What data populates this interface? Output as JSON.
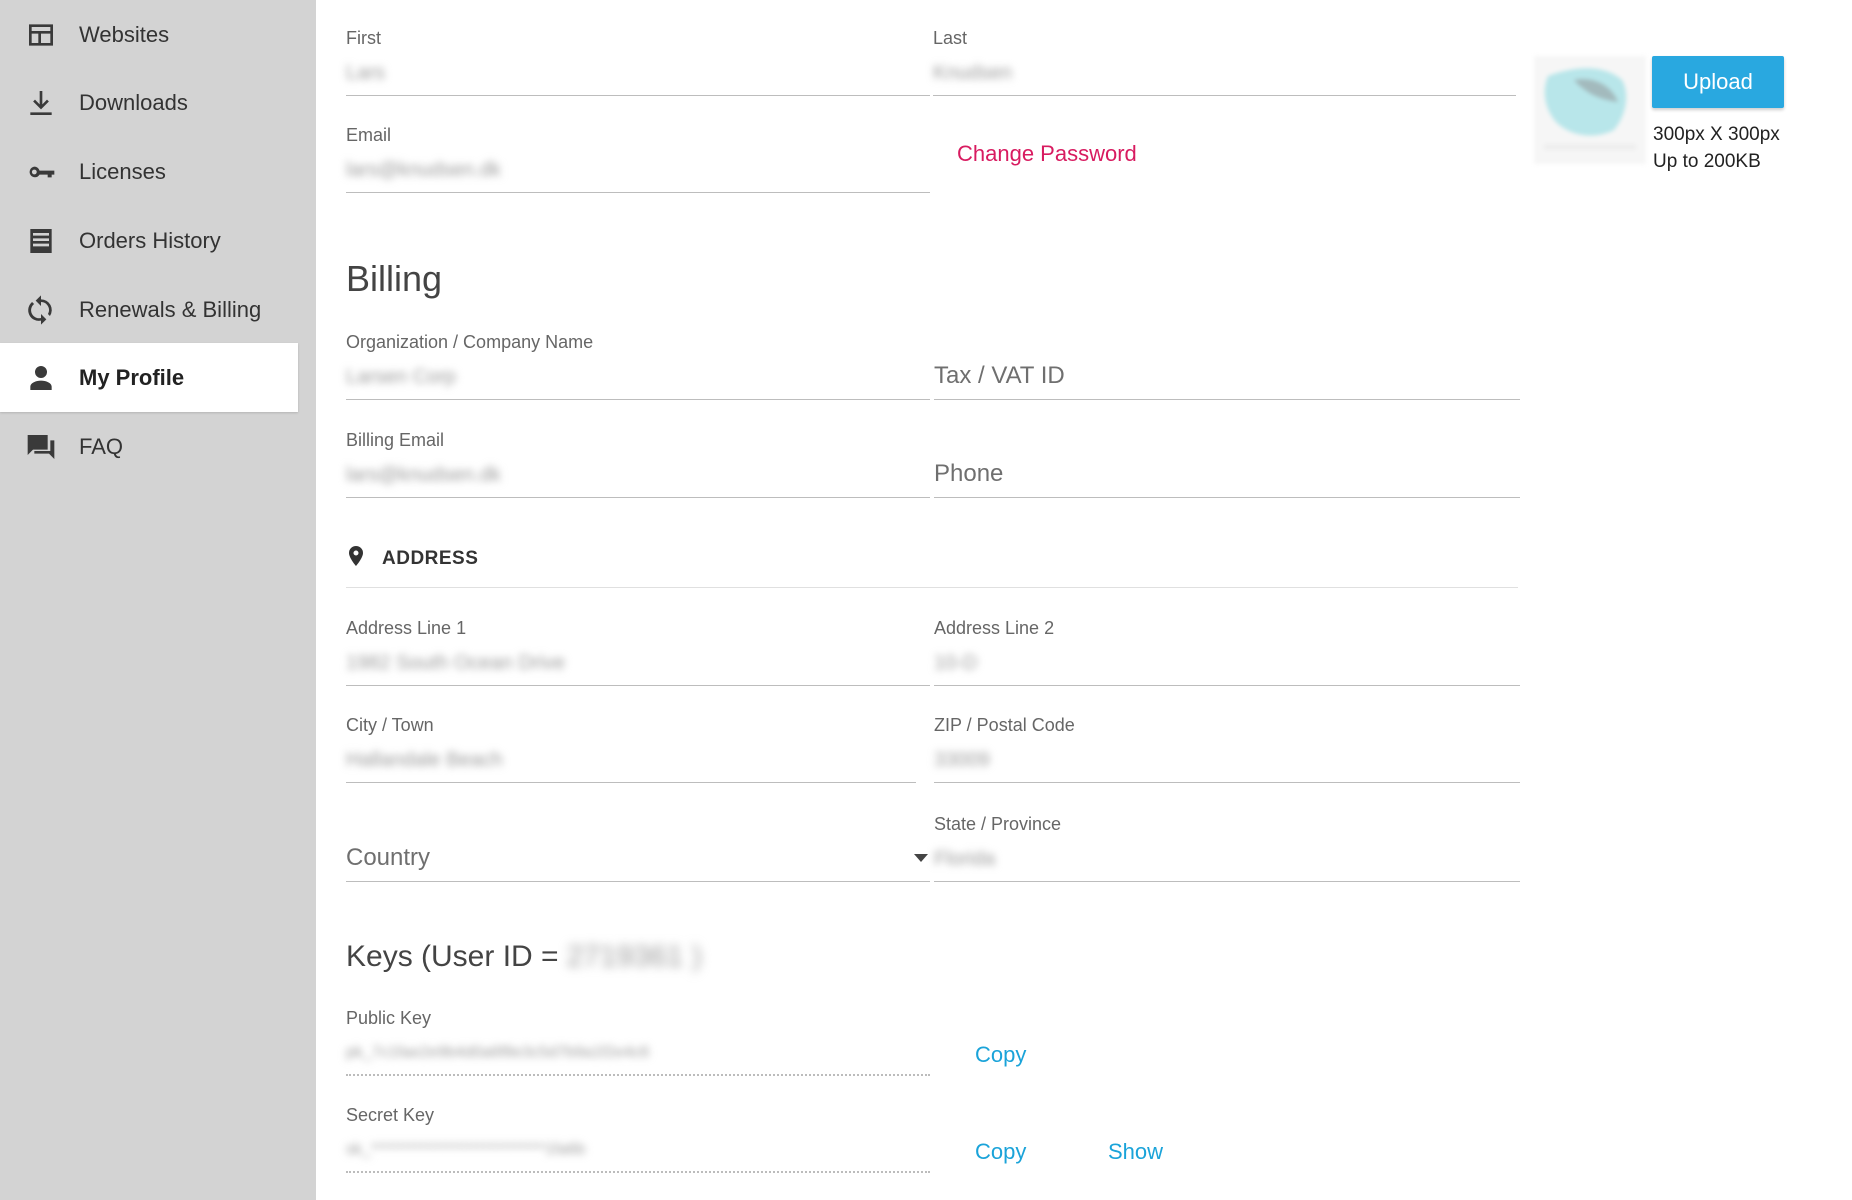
{
  "sidebar": {
    "items": [
      {
        "label": "Websites",
        "icon": "websites-icon",
        "active": false
      },
      {
        "label": "Downloads",
        "icon": "download-icon",
        "active": false
      },
      {
        "label": "Licenses",
        "icon": "key-icon",
        "active": false
      },
      {
        "label": "Orders History",
        "icon": "list-icon",
        "active": false
      },
      {
        "label": "Renewals & Billing",
        "icon": "refresh-icon",
        "active": false
      },
      {
        "label": "My Profile",
        "icon": "person-icon",
        "active": true
      },
      {
        "label": "FAQ",
        "icon": "chat-icon",
        "active": false
      }
    ]
  },
  "profile": {
    "first": {
      "label": "First",
      "value": "Lars"
    },
    "last": {
      "label": "Last",
      "value": "Knudsen"
    },
    "email": {
      "label": "Email",
      "value": "lars@knudsen.dk"
    },
    "change_password": "Change Password",
    "upload": {
      "button": "Upload",
      "note_size": "300px X 300px",
      "note_limit": "Up to 200KB"
    }
  },
  "billing": {
    "title": "Billing",
    "company": {
      "label": "Organization / Company Name",
      "value": "Larsen Corp"
    },
    "tax": {
      "placeholder": "Tax / VAT ID"
    },
    "billing_email": {
      "label": "Billing Email",
      "value": "lars@knudsen.dk"
    },
    "phone": {
      "placeholder": "Phone"
    }
  },
  "address": {
    "heading": "ADDRESS",
    "line1": {
      "label": "Address Line 1",
      "value": "1982 South Ocean Drive"
    },
    "line2": {
      "label": "Address Line 2",
      "value": "10-D"
    },
    "city": {
      "label": "City / Town",
      "value": "Hallandale Beach"
    },
    "zip": {
      "label": "ZIP / Postal Code",
      "value": "33009"
    },
    "country": {
      "placeholder": "Country"
    },
    "state": {
      "label": "State / Province",
      "value": "Florida"
    }
  },
  "keys": {
    "title_prefix": "Keys (User ID =",
    "user_id": "2719361 )",
    "public_key": {
      "label": "Public Key",
      "value": "pk_7c1fae2e9b4d0a6f8e3c5d7b9a1f2e4c6",
      "copy": "Copy"
    },
    "secret_key": {
      "label": "Secret Key",
      "value": "sk_****************************1fa6b",
      "copy": "Copy",
      "show": "Show"
    }
  },
  "colors": {
    "sidebar_bg": "#d3d3d3",
    "accent_blue": "#29a8e0",
    "link_pink": "#d81b60",
    "link_blue": "#1aa3d9"
  }
}
